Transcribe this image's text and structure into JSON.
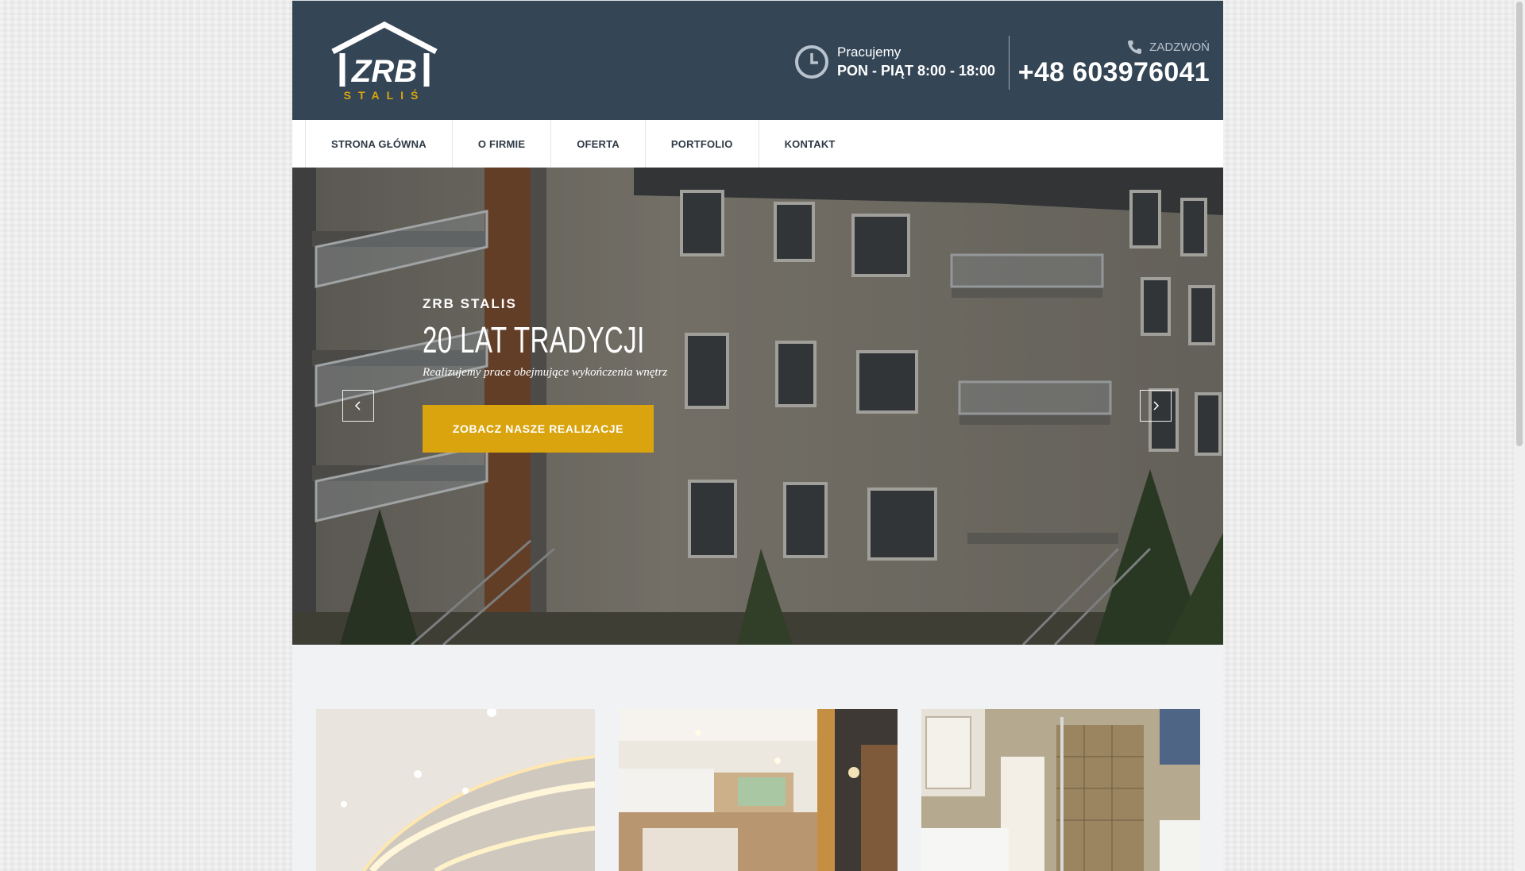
{
  "header": {
    "logo_text": "ZRB",
    "logo_subtext": "STALIŚ",
    "hours_label": "Pracujemy",
    "hours_value": "PON - PIĄT 8:00 - 18:00",
    "call_label": "ZADZWOŃ",
    "phone": "+48 603976041"
  },
  "nav": {
    "items": [
      {
        "label": "STRONA GŁÓWNA"
      },
      {
        "label": "O FIRMIE"
      },
      {
        "label": "OFERTA"
      },
      {
        "label": "PORTFOLIO"
      },
      {
        "label": "KONTAKT"
      }
    ]
  },
  "hero": {
    "kicker": "ZRB STALIS",
    "title": "20 LAT TRADYCJI",
    "subtitle": "Realizujemy prace obejmujące wykończenia wnętrz",
    "button": "ZOBACZ NASZE REALIZACJE",
    "prev_icon": "chevron-left-icon",
    "next_icon": "chevron-right-icon"
  },
  "colors": {
    "header_bg": "#344556",
    "accent": "#d9a40d",
    "nav_text": "#2e3a46"
  }
}
